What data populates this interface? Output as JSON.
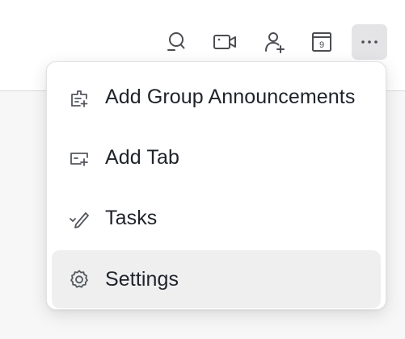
{
  "toolbar": {
    "buttons": [
      {
        "icon": "search-icon"
      },
      {
        "icon": "video-call-icon"
      },
      {
        "icon": "add-member-icon"
      },
      {
        "icon": "calendar-icon",
        "day": "9"
      },
      {
        "icon": "more-icon"
      }
    ]
  },
  "menu": {
    "items": [
      {
        "label": "Add Group Announcements",
        "icon": "announcement-icon"
      },
      {
        "label": "Add Tab",
        "icon": "add-tab-icon"
      },
      {
        "label": "Tasks",
        "icon": "tasks-icon"
      },
      {
        "label": "Settings",
        "icon": "gear-icon",
        "hovered": true
      }
    ]
  },
  "colors": {
    "icon": "#4b4d52",
    "text": "#1f2329",
    "hover_bg": "#efeff0",
    "more_button_bg": "#e4e4e6"
  }
}
